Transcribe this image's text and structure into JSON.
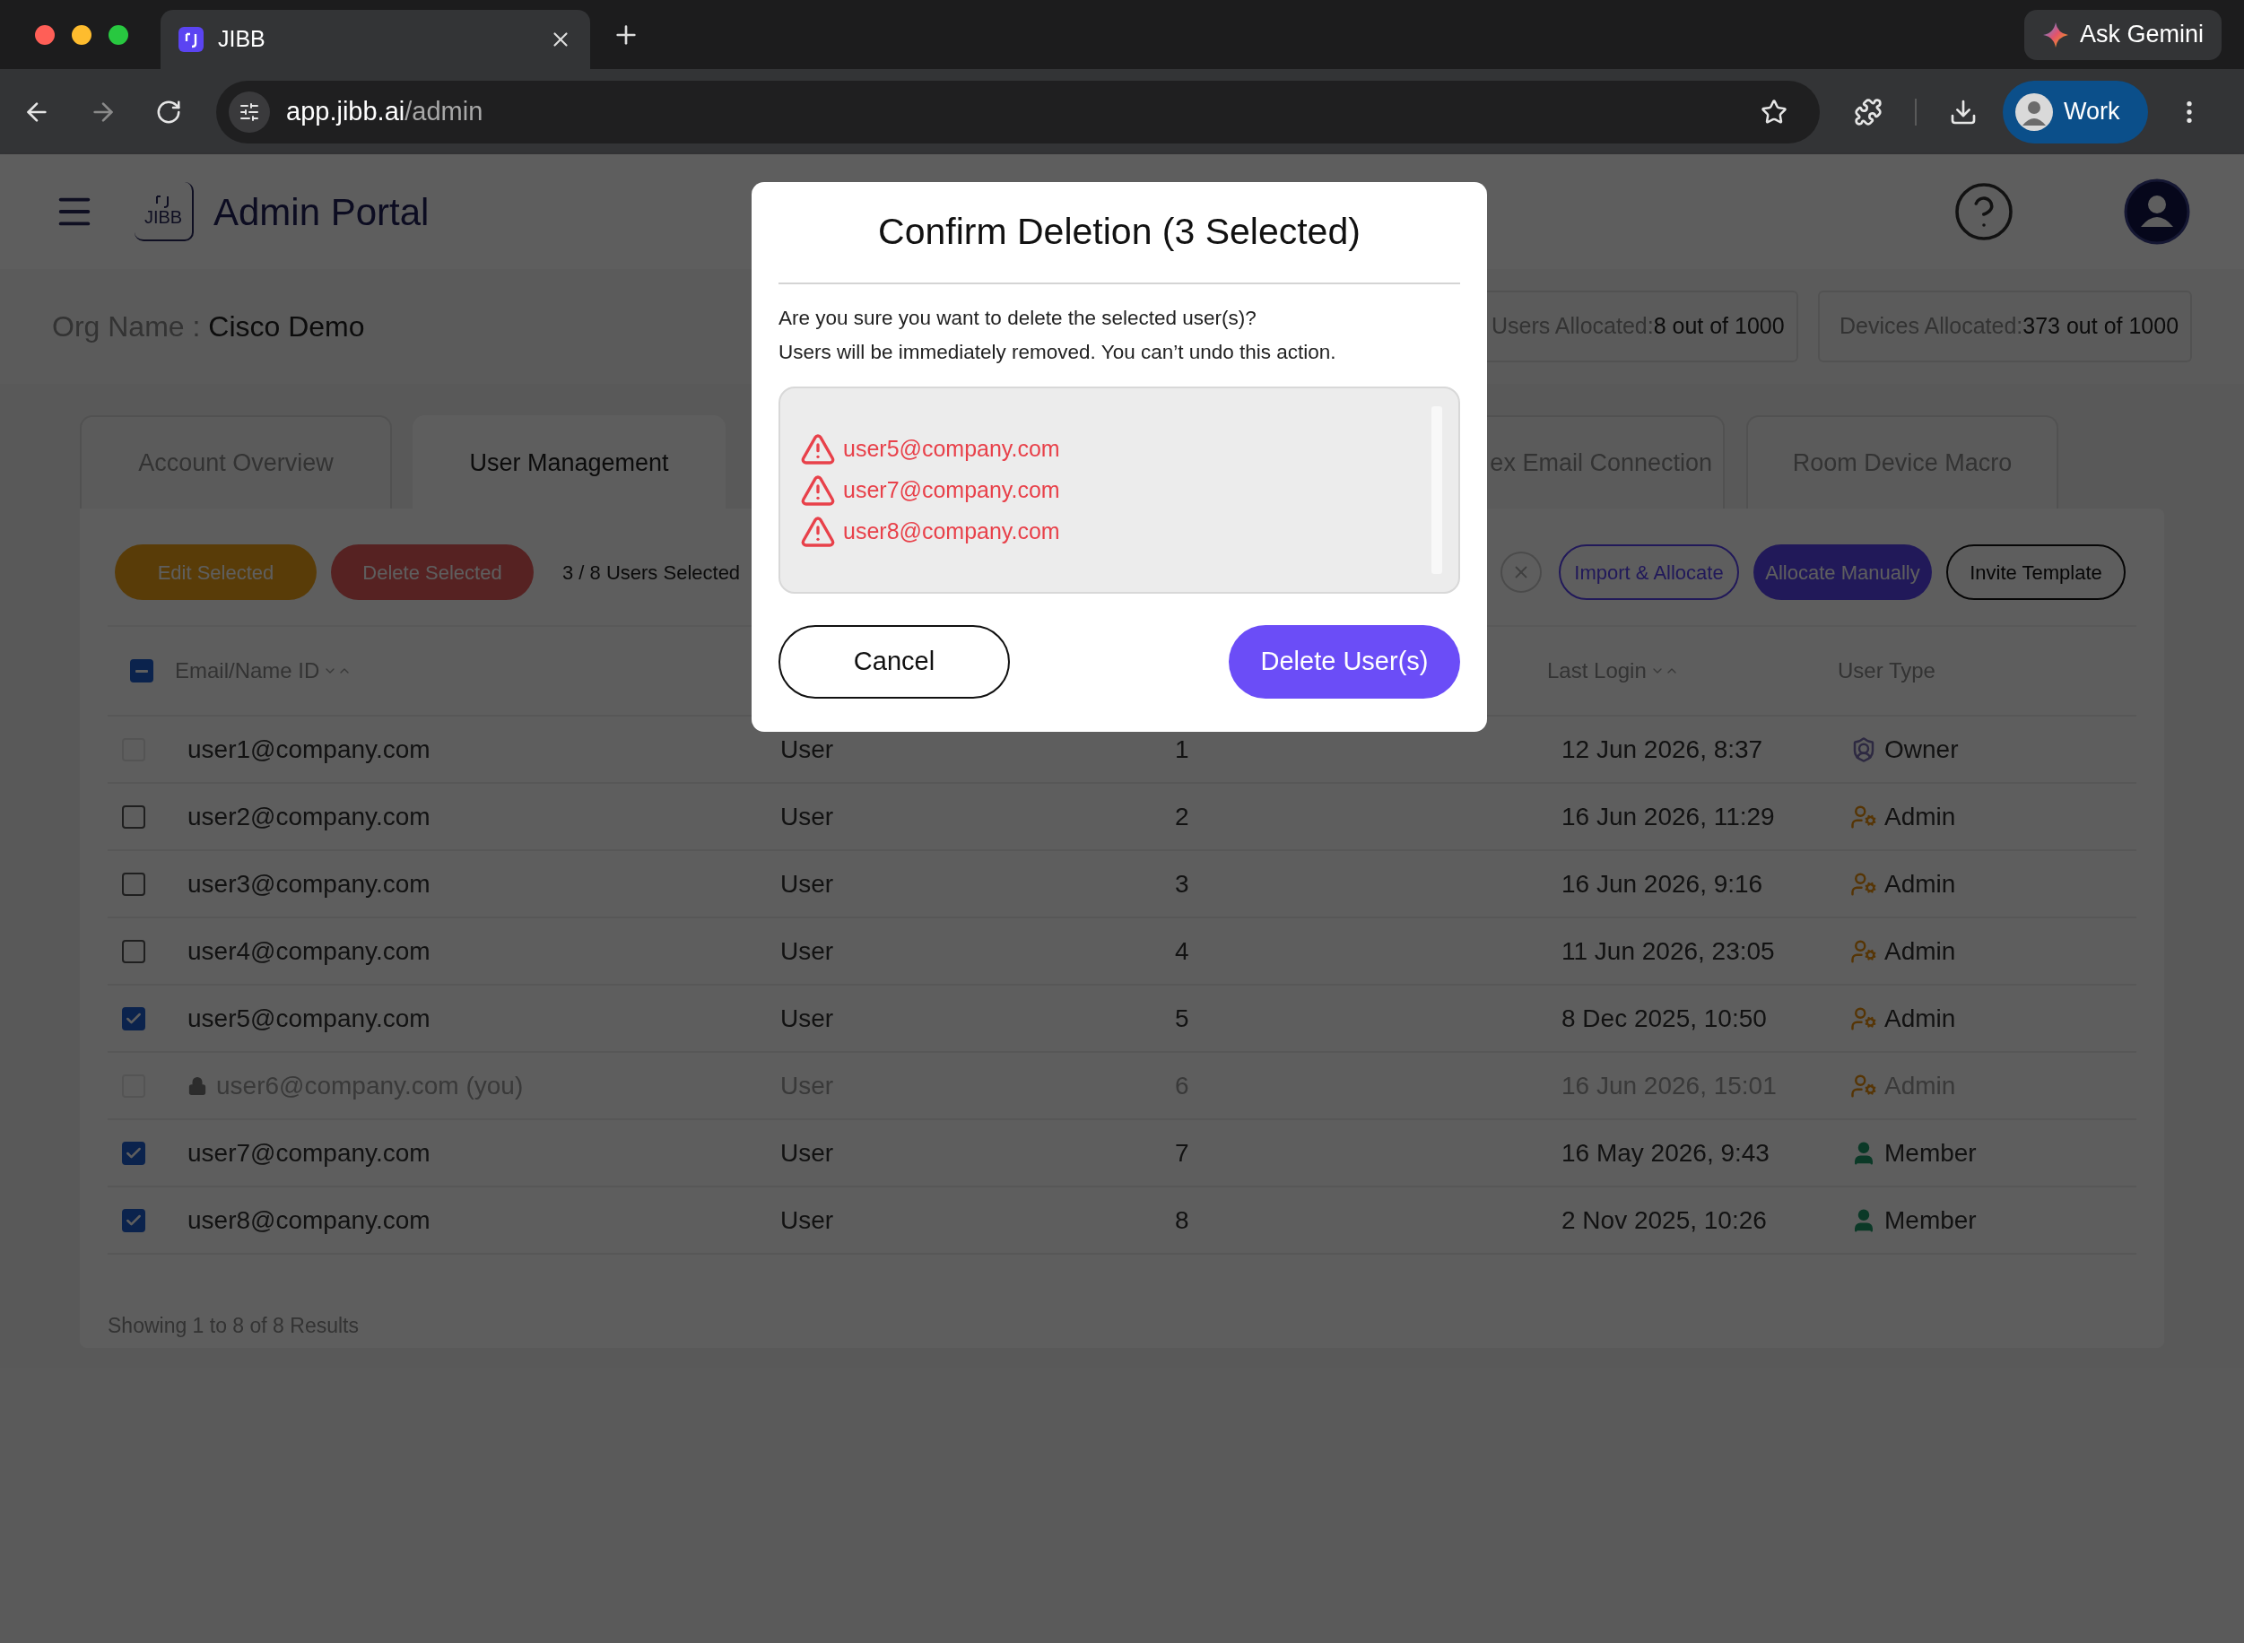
{
  "browser": {
    "tab": {
      "title": "JIBB"
    },
    "ask_gemini": "Ask Gemini",
    "address": {
      "host": "app.jibb.ai",
      "path": "/admin"
    },
    "profile": "Work"
  },
  "header": {
    "logo_text": "JIBB",
    "title": "Admin Portal"
  },
  "org": {
    "label": "Org Name : ",
    "value": "Cisco Demo"
  },
  "stats": [
    {
      "label": "Users Allocated:",
      "value": "8 out of 1000"
    },
    {
      "label": "Devices Allocated:",
      "value": "373 out of 1000"
    }
  ],
  "tabs": [
    {
      "label": "Account Overview",
      "selected": false
    },
    {
      "label": "User Management",
      "selected": true
    },
    {
      "label": "ex Email Connection",
      "selected": false
    },
    {
      "label": "Room Device Macro",
      "selected": false
    }
  ],
  "toolbar": {
    "edit": "Edit Selected",
    "delete": "Delete Selected",
    "selection_count": "3 / 8 Users Selected",
    "import": "Import & Allocate",
    "allocate": "Allocate Manually",
    "invite": "Invite Template"
  },
  "table": {
    "select_all": {
      "indeterminate": true
    },
    "columns": [
      {
        "label": "Email/Name ID",
        "sortable": true
      },
      {
        "label": "Last Login",
        "sortable": true
      },
      {
        "label": "User Type",
        "sortable": false
      }
    ],
    "rows": [
      {
        "email": "user1@company.com",
        "column_2": "User",
        "column_3": "1",
        "last_login": "12 Jun 2026, 8:37",
        "user_type": "Owner",
        "kind": "owner",
        "checked": false,
        "disabled": true,
        "locked": false,
        "dimmed": false
      },
      {
        "email": "user2@company.com",
        "column_2": "User",
        "column_3": "2",
        "last_login": "16 Jun 2026, 11:29",
        "user_type": "Admin",
        "kind": "admin",
        "checked": false,
        "disabled": false,
        "locked": false,
        "dimmed": false
      },
      {
        "email": "user3@company.com",
        "column_2": "User",
        "column_3": "3",
        "last_login": "16 Jun 2026, 9:16",
        "user_type": "Admin",
        "kind": "admin",
        "checked": false,
        "disabled": false,
        "locked": false,
        "dimmed": false
      },
      {
        "email": "user4@company.com",
        "column_2": "User",
        "column_3": "4",
        "last_login": "11 Jun 2026, 23:05",
        "user_type": "Admin",
        "kind": "admin",
        "checked": false,
        "disabled": false,
        "locked": false,
        "dimmed": false
      },
      {
        "email": "user5@company.com",
        "column_2": "User",
        "column_3": "5",
        "last_login": "8 Dec 2025, 10:50",
        "user_type": "Admin",
        "kind": "admin",
        "checked": true,
        "disabled": false,
        "locked": false,
        "dimmed": false
      },
      {
        "email": "user6@company.com (you)",
        "column_2": "User",
        "column_3": "6",
        "last_login": "16 Jun 2026, 15:01",
        "user_type": "Admin",
        "kind": "admin",
        "checked": false,
        "disabled": true,
        "locked": true,
        "dimmed": true
      },
      {
        "email": "user7@company.com",
        "column_2": "User",
        "column_3": "7",
        "last_login": "16 May 2026, 9:43",
        "user_type": "Member",
        "kind": "member",
        "checked": true,
        "disabled": false,
        "locked": false,
        "dimmed": false
      },
      {
        "email": "user8@company.com",
        "column_2": "User",
        "column_3": "8",
        "last_login": "2 Nov 2025, 10:26",
        "user_type": "Member",
        "kind": "member",
        "checked": true,
        "disabled": false,
        "locked": false,
        "dimmed": false
      }
    ],
    "footer": "Showing 1 to 8 of 8 Results"
  },
  "dialog": {
    "title": "Confirm Deletion (3 Selected)",
    "lines": [
      "Are you sure you want to delete the selected user(s)?",
      "Users will be immediately removed. You can’t undo this action."
    ],
    "items": [
      "user5@company.com",
      "user7@company.com",
      "user8@company.com"
    ],
    "cancel": "Cancel",
    "confirm": "Delete User(s)"
  }
}
